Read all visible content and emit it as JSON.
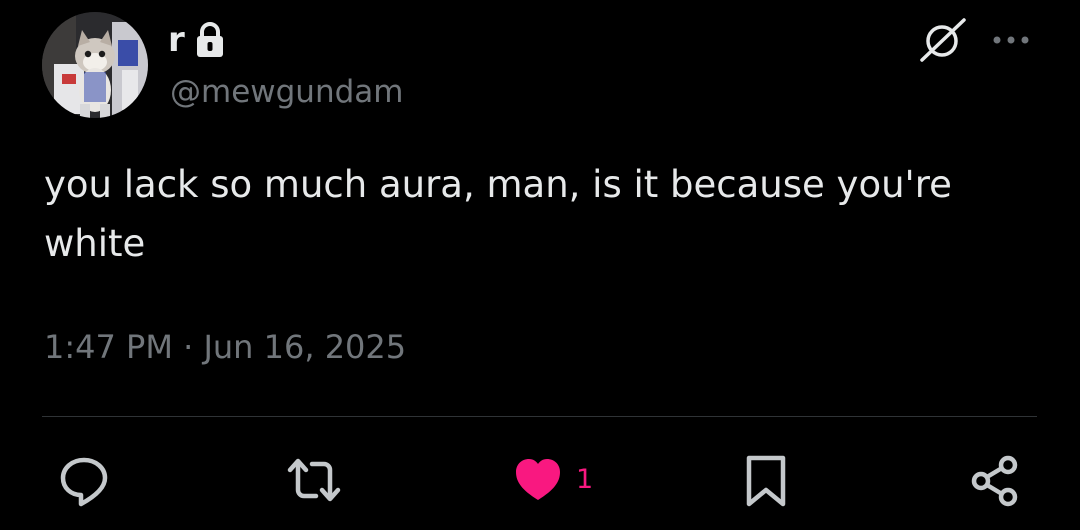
{
  "user": {
    "display_name": "r",
    "handle": "@mewgundam",
    "locked_icon": "lock-icon",
    "avatar_icon": "avatar"
  },
  "header": {
    "grok_icon": "grok-icon",
    "more_icon": "more-icon"
  },
  "tweet": {
    "text": "you lack so much aura, man, is it because you're white",
    "timestamp": "1:47 PM · Jun 16, 2025"
  },
  "actions": {
    "reply_icon": "reply-icon",
    "retweet_icon": "retweet-icon",
    "like_icon": "heart-icon",
    "like_count": "1",
    "bookmark_icon": "bookmark-icon",
    "share_icon": "share-icon"
  },
  "colors": {
    "background": "#000000",
    "text_primary": "#e7e9ea",
    "text_secondary": "#71767b",
    "divider": "#2f3336",
    "like_accent": "#f91880"
  }
}
